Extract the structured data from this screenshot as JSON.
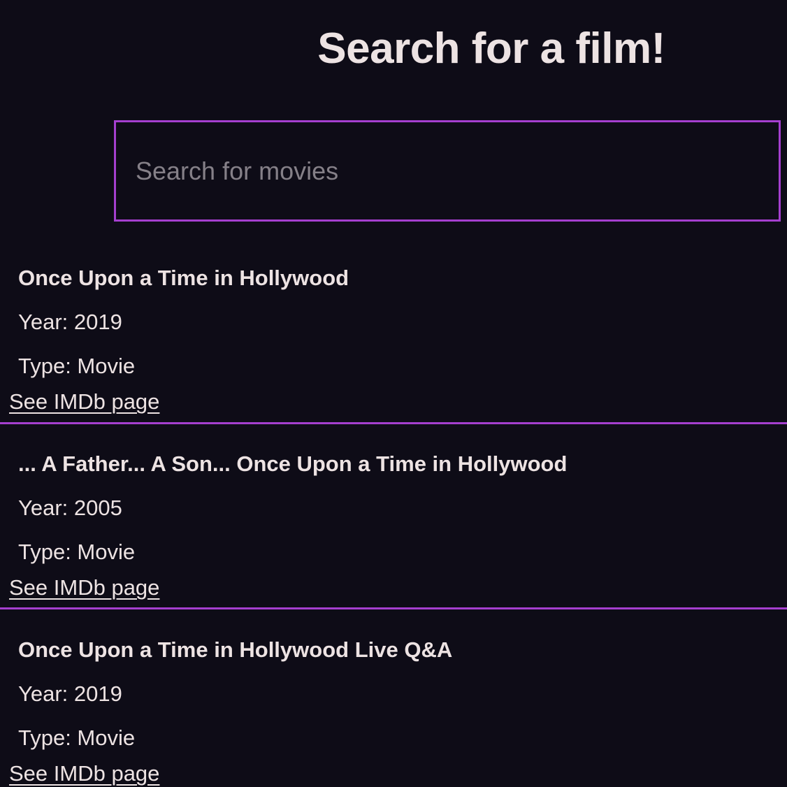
{
  "header": {
    "title": "Search for a film!"
  },
  "search": {
    "placeholder": "Search for movies",
    "value": ""
  },
  "results": [
    {
      "title": "Once Upon a Time in Hollywood",
      "year_label": "Year: 2019",
      "type_label": "Type: Movie",
      "link_label": "See IMDb page"
    },
    {
      "title": "... A Father... A Son... Once Upon a Time in Hollywood",
      "year_label": "Year: 2005",
      "type_label": "Type: Movie",
      "link_label": "See IMDb page"
    },
    {
      "title": "Once Upon a Time in Hollywood Live Q&A",
      "year_label": "Year: 2019",
      "type_label": "Type: Movie",
      "link_label": "See IMDb page"
    }
  ],
  "colors": {
    "background": "#0e0c17",
    "accent": "#a53fcf",
    "text": "#ede3e3"
  }
}
